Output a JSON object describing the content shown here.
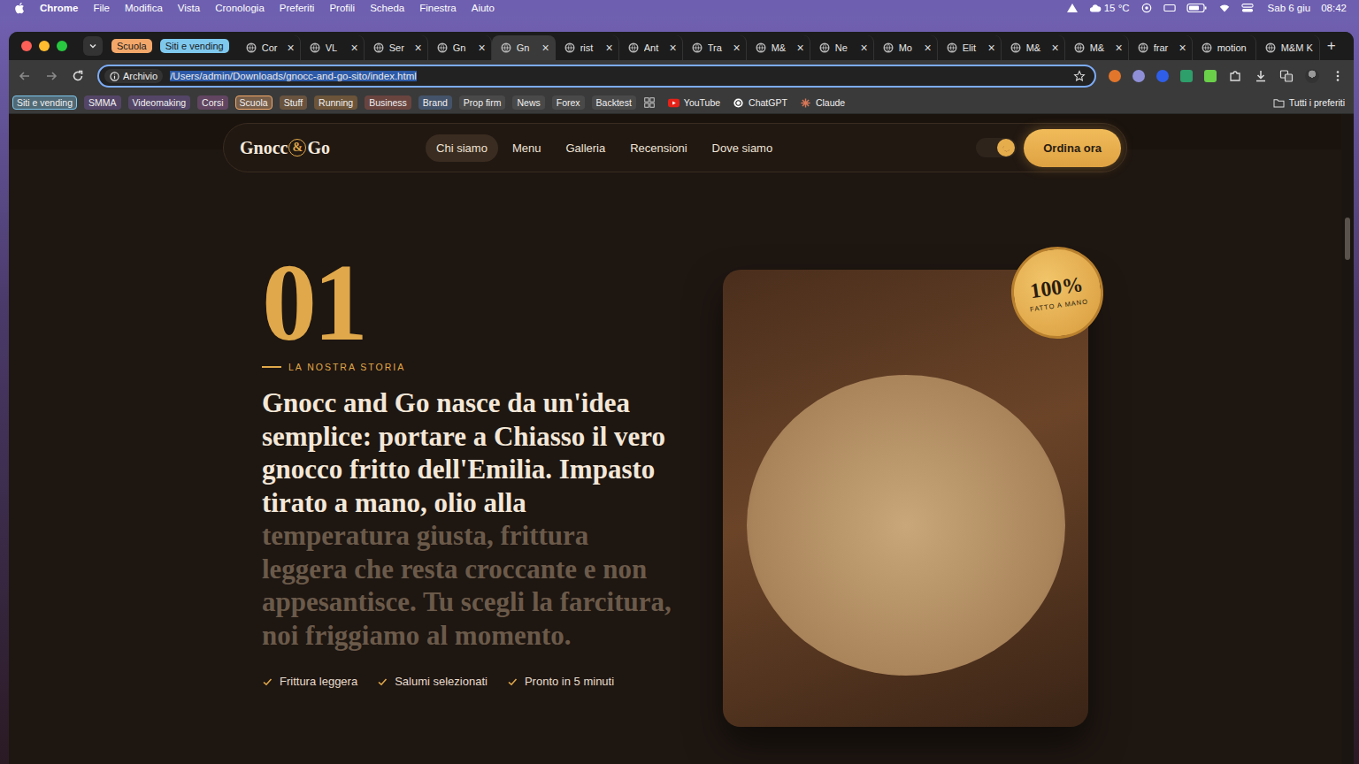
{
  "menubar": {
    "app": "Chrome",
    "menus": [
      "File",
      "Modifica",
      "Vista",
      "Cronologia",
      "Preferiti",
      "Profili",
      "Scheda",
      "Finestra",
      "Aiuto"
    ],
    "weather": "15 °C",
    "date": "Sab 6 giu",
    "time": "08:42"
  },
  "tab_groups": [
    {
      "label": "Scuola",
      "color": "#f3a86a"
    },
    {
      "label": "Siti e vending",
      "color": "#7ec8ee"
    }
  ],
  "tabs": [
    {
      "label": "Cor",
      "selected": false,
      "closable": true
    },
    {
      "label": "VL",
      "selected": false,
      "closable": true
    },
    {
      "label": "Ser",
      "selected": false,
      "closable": true
    },
    {
      "label": "Gn",
      "selected": false,
      "closable": true
    },
    {
      "label": "Gn",
      "selected": true,
      "closable": true
    },
    {
      "label": "rist",
      "selected": false,
      "closable": true
    },
    {
      "label": "Ant",
      "selected": false,
      "closable": true
    },
    {
      "label": "Tra",
      "selected": false,
      "closable": true
    },
    {
      "label": "M&",
      "selected": false,
      "closable": true
    },
    {
      "label": "Ne",
      "selected": false,
      "closable": true
    },
    {
      "label": "Mo",
      "selected": false,
      "closable": true
    },
    {
      "label": "Elit",
      "selected": false,
      "closable": true
    },
    {
      "label": "M&",
      "selected": false,
      "closable": true
    },
    {
      "label": "M&",
      "selected": false,
      "closable": true
    },
    {
      "label": "frar",
      "selected": false,
      "closable": true
    },
    {
      "label": "motion",
      "selected": false,
      "closable": false
    },
    {
      "label": "M&M K",
      "selected": false,
      "closable": false
    }
  ],
  "tab_close": "×",
  "new_tab": "+",
  "address_bar": {
    "chip": "Archivio",
    "url": "/Users/admin/Downloads/gnocc-and-go-sito/index.html",
    "selected": true
  },
  "bookmarks": [
    {
      "label": "Siti e vending",
      "color": "#7ec8ee",
      "open": true
    },
    {
      "label": "SMMA",
      "color": "#8a5cc2",
      "open": false
    },
    {
      "label": "Videomaking",
      "color": "#8a5cc2",
      "open": false
    },
    {
      "label": "Corsi",
      "color": "#b05cb0",
      "open": false
    },
    {
      "label": "Scuola",
      "color": "#f3a86a",
      "open": true
    },
    {
      "label": "Stuff",
      "color": "#c8874a",
      "open": false
    },
    {
      "label": "Running",
      "color": "#d08a3a",
      "open": false
    },
    {
      "label": "Business",
      "color": "#c85a4a",
      "open": false
    },
    {
      "label": "Brand",
      "color": "#5a88c8",
      "open": false
    },
    {
      "label": "Prop firm",
      "color": "#6a6a6a",
      "open": false
    },
    {
      "label": "News",
      "color": "#6a6a6a",
      "open": false
    },
    {
      "label": "Forex",
      "color": "#6a6a6a",
      "open": false
    },
    {
      "label": "Backtest",
      "color": "#6a6a6a",
      "open": false
    }
  ],
  "bookmark_links": [
    "YouTube",
    "ChatGPT",
    "Claude"
  ],
  "all_bookmarks": "Tutti i preferiti",
  "site": {
    "logo": {
      "left": "Gnocc",
      "mark": "&",
      "right": "Go"
    },
    "nav": [
      {
        "label": "Chi siamo",
        "selected": true
      },
      {
        "label": "Menu",
        "selected": false
      },
      {
        "label": "Galleria",
        "selected": false
      },
      {
        "label": "Recensioni",
        "selected": false
      },
      {
        "label": "Dove siamo",
        "selected": false
      }
    ],
    "theme_toggle": {
      "dark": true
    },
    "cta": "Ordina ora",
    "section": {
      "number": "01",
      "eyebrow": "LA NOSTRA STORIA",
      "lead_revealed": "Gnocc and Go nasce da un'idea semplice: portare a Chiasso il vero gnocco fritto dell'Emilia. Impasto tirato a mano, olio alla ",
      "lead_dim": "temperatura giusta, frittura leggera che resta croccante e non appesantisce. Tu scegli la farcitura, noi friggiamo al momento.",
      "features": [
        "Frittura leggera",
        "Salumi selezionati",
        "Pronto in 5 minuti"
      ],
      "badge": {
        "value": "100%",
        "caption": "FATTO A MANO"
      }
    }
  },
  "scrollbar": {
    "level": 0.07
  }
}
